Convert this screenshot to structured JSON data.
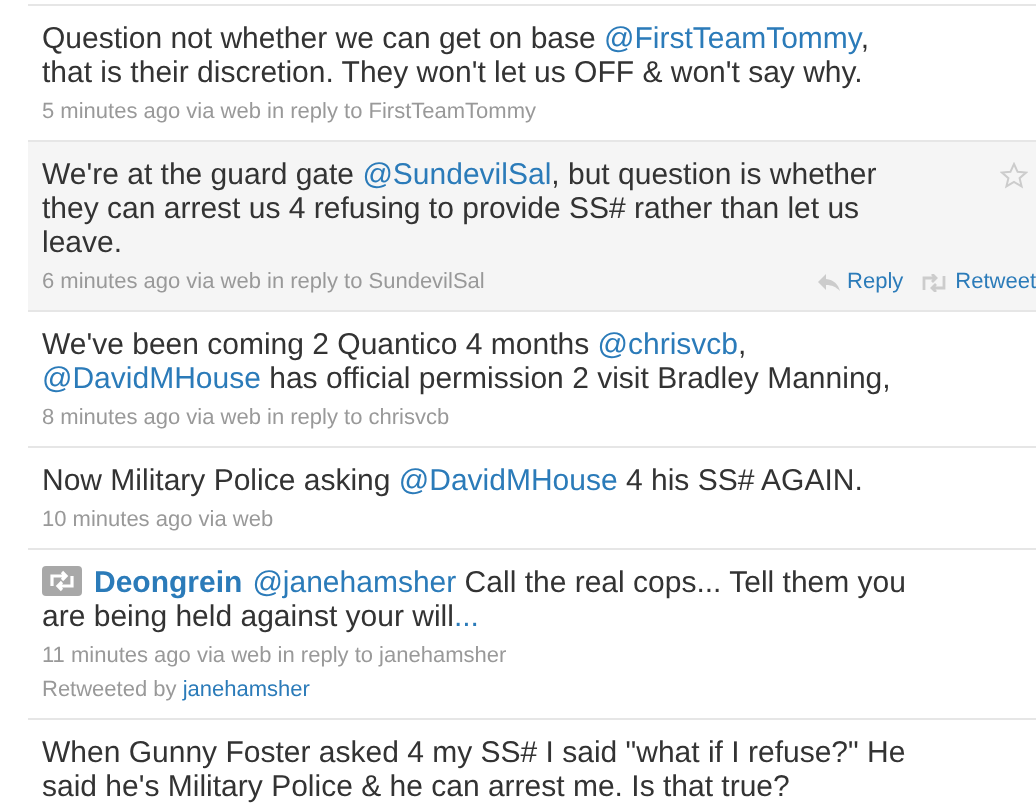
{
  "tweets": [
    {
      "hovered": false,
      "text": [
        {
          "kind": "plain",
          "text": "Question not whether we can get on base "
        },
        {
          "kind": "mention",
          "text": "@FirstTeamTommy"
        },
        {
          "kind": "plain",
          "text": ", that is their discretion. They won't let us OFF & won't say why."
        }
      ],
      "meta": "5 minutes ago via web in reply to FirstTeamTommy"
    },
    {
      "hovered": true,
      "text": [
        {
          "kind": "plain",
          "text": "We're at the guard gate "
        },
        {
          "kind": "mention",
          "text": "@SundevilSal"
        },
        {
          "kind": "plain",
          "text": ", but question is whether they can arrest us 4 refusing to provide SS# rather than let us leave."
        }
      ],
      "meta": "6 minutes ago via web in reply to SundevilSal",
      "actions": [
        "Reply",
        "Retweet"
      ]
    },
    {
      "hovered": false,
      "text": [
        {
          "kind": "plain",
          "text": "We've been coming 2 Quantico 4 months "
        },
        {
          "kind": "mention",
          "text": "@chrisvcb"
        },
        {
          "kind": "plain",
          "text": ", "
        },
        {
          "kind": "mention",
          "text": "@DavidMHouse"
        },
        {
          "kind": "plain",
          "text": " has official permission 2 visit Bradley Manning,"
        }
      ],
      "meta": "8 minutes ago via web in reply to chrisvcb"
    },
    {
      "hovered": false,
      "text": [
        {
          "kind": "plain",
          "text": "Now Military Police asking "
        },
        {
          "kind": "mention",
          "text": "@DavidMHouse"
        },
        {
          "kind": "plain",
          "text": " 4 his SS# AGAIN."
        }
      ],
      "meta": "10 minutes ago via web"
    },
    {
      "hovered": false,
      "author": "Deongrein",
      "text": [
        {
          "kind": "mention",
          "text": "@janehamsher"
        },
        {
          "kind": "plain",
          "text": " Call the real cops... Tell them you are being held against your will"
        },
        {
          "kind": "mention",
          "text": "..."
        }
      ],
      "meta": "11 minutes ago via web in reply to janehamsher",
      "retweeted_by": {
        "label": "Retweeted by",
        "user": "janehamsher"
      }
    },
    {
      "hovered": false,
      "text": [
        {
          "kind": "plain",
          "text": "When Gunny Foster asked 4 my SS# I said \"what if I refuse?\" He said he's Military Police & he can arrest me. Is that true?"
        }
      ]
    }
  ]
}
